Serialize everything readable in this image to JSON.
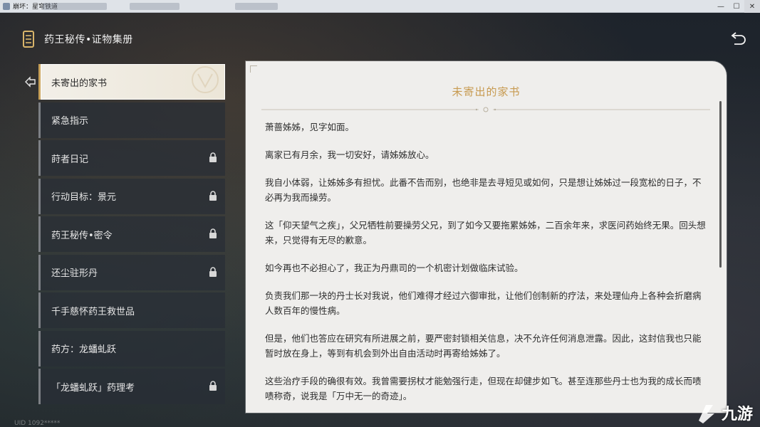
{
  "window": {
    "title": "崩坏：星穹铁道",
    "controls": {
      "minimize": "—",
      "maximize": "☐",
      "close": "✕"
    }
  },
  "header": {
    "title": "药王秘传•证物集册",
    "book_icon": "book-icon",
    "back_icon": "back-arrow-icon"
  },
  "list": {
    "items": [
      {
        "label": "未寄出的家书",
        "locked": false,
        "active": true
      },
      {
        "label": "紧急指示",
        "locked": false,
        "active": false
      },
      {
        "label": "莳者日记",
        "locked": true,
        "active": false
      },
      {
        "label": "行动目标：景元",
        "locked": true,
        "active": false
      },
      {
        "label": "药王秘传•密令",
        "locked": true,
        "active": false
      },
      {
        "label": "还尘驻形丹",
        "locked": true,
        "active": false
      },
      {
        "label": "千手慈怀药王救世品",
        "locked": false,
        "active": false
      },
      {
        "label": "药方：龙蟠虬跃",
        "locked": false,
        "active": false
      },
      {
        "label": "「龙蟠虬跃」药理考",
        "locked": true,
        "active": false
      }
    ]
  },
  "document": {
    "title": "未寄出的家书",
    "paragraphs": [
      "萧蔷姊姊，见字如面。",
      "离家已有月余，我一切安好，请姊姊放心。",
      "我自小体弱，让姊姊多有担忧。此番不告而别，也绝非是去寻短见或如何，只是想让姊姊过一段宽松的日子，不必再为我而操劳。",
      "这「仰天望气之疾」，父兄牺牲前要操劳父兄，到了如今又要拖累姊姊，二百余年来，求医问药始终无果。回头想来，只觉得有无尽的歉意。",
      "如今再也不必担心了，我正为丹鼎司的一个机密计划做临床试验。",
      "负责我们那一块的丹士长对我说，他们难得才经过六御审批，让他们创制新的疗法，来处理仙舟上各种会折磨病人数百年的慢性病。",
      "但是，他们也答应在研究有所进展之前，要严密封锁相关信息，决不允许任何消息泄露。因此，这封信我也只能暂时放在身上，等到有机会到外出自由活动时再寄给姊姊了。",
      "这些治疗手段的确很有效。我曾需要拐杖才能勉强行走，但现在却健步如飞。甚至连那些丹士也为我的成长而啧啧称奇，说我是「万中无一的奇迹」。"
    ]
  },
  "watermark": {
    "text": "九游"
  },
  "uid": {
    "text": "UID 1092*****"
  },
  "colors": {
    "accent_gold": "#c79a50",
    "panel_bg": "#efeeec",
    "active_item_bg": "#f2efe8"
  }
}
